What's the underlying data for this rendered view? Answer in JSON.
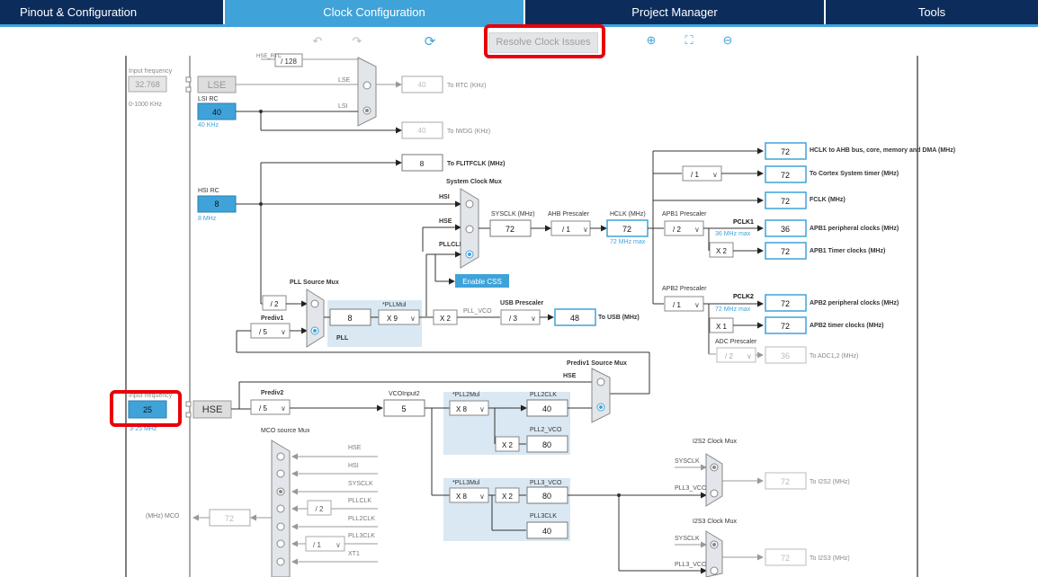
{
  "tabs": [
    {
      "label": "Pinout & Configuration",
      "active": false
    },
    {
      "label": "Clock Configuration",
      "active": true
    },
    {
      "label": "Project Manager",
      "active": false
    },
    {
      "label": "Tools",
      "active": false
    }
  ],
  "toolbar": {
    "undo_icon": "undo-icon",
    "redo_icon": "redo-icon",
    "refresh_icon": "refresh-icon",
    "resolve_label": "Resolve Clock Issues",
    "zoom_in_icon": "zoom-in-icon",
    "fit_icon": "fit-icon",
    "zoom_out_icon": "zoom-out-icon"
  },
  "colors": {
    "accent": "#3fa3d9",
    "nav": "#0c2c5c",
    "highlight": "#e8000b",
    "panel": "#d9e8f3"
  },
  "lse": {
    "freq_label": "Input frequency",
    "freq_value": "32.768",
    "range": "0-1000 KHz",
    "block": "LSE",
    "div": "/ 128",
    "hse_rtc": "HSE_RTC",
    "lse_line": "LSE",
    "lsi_line": "LSI",
    "rtc_value": "40",
    "rtc_label": "To RTC (KHz)",
    "iwdg_value": "40",
    "iwdg_label": "To IWDG (KHz)"
  },
  "lsi": {
    "title": "LSI RC",
    "value": "40",
    "unit": "40 KHz"
  },
  "flit": {
    "value": "8",
    "label": "To FLITFCLK (MHz)"
  },
  "hsi": {
    "title": "HSI RC",
    "value": "8",
    "unit": "8 MHz"
  },
  "sysmux": {
    "title": "System Clock Mux",
    "hsi": "HSI",
    "hse": "HSE",
    "pllclk": "PLLCLK",
    "css": "Enable CSS",
    "sysclk_label": "SYSCLK (MHz)",
    "sysclk": "72",
    "ahb_label": "AHB Prescaler",
    "ahb": "/ 1",
    "hclk_label": "HCLK (MHz)",
    "hclk": "72",
    "hclk_max": "72 MHz max"
  },
  "outputs": {
    "hclk_ahb": "72",
    "hclk_ahb_label": "HCLK to AHB bus, core, memory and DMA (MHz)",
    "cortex_div": "/ 1",
    "cortex": "72",
    "cortex_label": "To Cortex System timer (MHz)",
    "fclk": "72",
    "fclk_label": "FCLK (MHz)",
    "apb1_label": "APB1 Prescaler",
    "apb1": "/ 2",
    "pclk1": "PCLK1",
    "pclk1_max": "36 MHz max",
    "apb1_periph": "36",
    "apb1_periph_label": "APB1 peripheral clocks (MHz)",
    "apb1_x": "X 2",
    "apb1_timer": "72",
    "apb1_timer_label": "APB1 Timer clocks (MHz)",
    "apb2_label": "APB2 Prescaler",
    "apb2": "/ 1",
    "pclk2": "PCLK2",
    "pclk2_max": "72 MHz max",
    "apb2_periph": "72",
    "apb2_periph_label": "APB2 peripheral clocks (MHz)",
    "apb2_x": "X 1",
    "apb2_timer": "72",
    "apb2_timer_label": "APB2 timer clocks (MHz)",
    "adc_label": "ADC Prescaler",
    "adc": "/ 2",
    "adc_value": "36",
    "adc_out": "To ADC1,2 (MHz)"
  },
  "pll": {
    "title": "PLL Source Mux",
    "div2": "/ 2",
    "prediv1_label": "Prediv1",
    "prediv1": "/ 5",
    "value": "8",
    "mul_label": "*PLLMul",
    "mul": "X 9",
    "pll_label": "PLL",
    "x2": "X 2",
    "vco": "PLL_VCO",
    "usb_label": "USB Prescaler",
    "usb": "/ 3",
    "usb_value": "48",
    "usb_out": "To USB (MHz)"
  },
  "hse": {
    "freq_label": "Input frequency",
    "freq_value": "25",
    "range": "3-25 MHz",
    "block": "HSE",
    "prediv2_label": "Prediv2",
    "prediv2": "/ 5",
    "vcoinput_label": "VCOInput2",
    "vcoinput": "5",
    "prediv1_src": "Prediv1 Source Mux",
    "hse_line": "HSE"
  },
  "pll2": {
    "mul_label": "*PLL2Mul",
    "mul": "X 8",
    "clk_label": "PLL2CLK",
    "clk": "40",
    "vco_label": "PLL2_VCO",
    "x2": "X 2",
    "vco": "80"
  },
  "pll3": {
    "mul_label": "*PLL3Mul",
    "mul": "X 8",
    "x2": "X 2",
    "vco_label": "PLL3_VCO",
    "vco": "80",
    "clk_label": "PLL3CLK",
    "clk": "40"
  },
  "mco": {
    "title": "MCO source Mux",
    "hse": "HSE",
    "hsi": "HSI",
    "sysclk": "SYSCLK",
    "pllclk": "PLLCLK",
    "pll2clk": "PLL2CLK",
    "pll3clk": "PLL3CLK",
    "xt1": "XT1",
    "div2": "/ 2",
    "div1": "/ 1",
    "out_label": "(MHz) MCO",
    "out": "72"
  },
  "i2s": {
    "mux2": "I2S2 Clock Mux",
    "sysclk2": "SYSCLK",
    "pll3vco2": "PLL3_VCO",
    "i2s2_value": "72",
    "i2s2_label": "To I2S2 (MHz)",
    "mux3": "I2S3 Clock Mux",
    "sysclk3": "SYSCLK",
    "pll3vco3": "PLL3_VCO",
    "i2s3_value": "72",
    "i2s3_label": "To I2S3 (MHz)"
  }
}
